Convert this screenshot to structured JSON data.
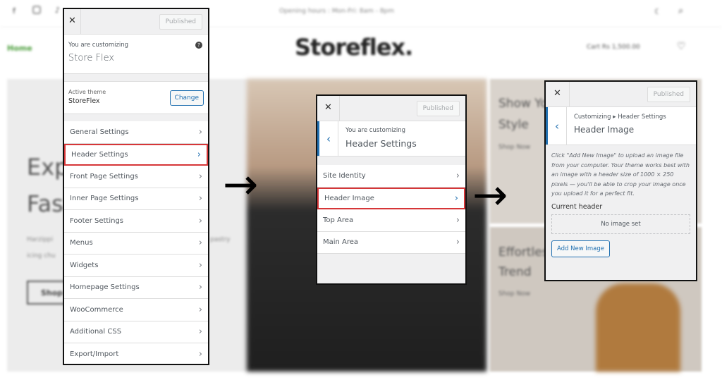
{
  "website": {
    "social_icons": [
      "facebook-icon",
      "instagram-icon",
      "tiktok-icon"
    ],
    "opening_hours": "Opening hours : Mon-Fri: 8am - 8pm",
    "nav_home": "Home",
    "logo": "Storeflex.",
    "cart_text": "Cart Rs 1,500.00",
    "hero_title_1": "Exp",
    "hero_title_2": "Fas",
    "hero_body_1": "Harzippi",
    "hero_body_2": "icing chu",
    "hero_body_3": "pastry",
    "hero_button": "Shop",
    "card1_title_1": "Show Yo",
    "card1_title_2": "Style",
    "card1_link": "Shop Now",
    "card2_title_1": "Effortless",
    "card2_title_2": "Trend",
    "card2_link": "Shop Now",
    "accent": "#2271b1",
    "highlight": "#d63638"
  },
  "panel1": {
    "close": "✕",
    "published": "Published",
    "customizing_label": "You are customizing",
    "site_name": "Store Flex",
    "active_theme_label": "Active theme",
    "theme_name": "StoreFlex",
    "change": "Change",
    "items": [
      {
        "label": "General Settings"
      },
      {
        "label": "Header Settings"
      },
      {
        "label": "Front Page Settings"
      },
      {
        "label": "Inner Page Settings"
      },
      {
        "label": "Footer Settings"
      },
      {
        "label": "Menus"
      },
      {
        "label": "Widgets"
      },
      {
        "label": "Homepage Settings"
      },
      {
        "label": "WooCommerce"
      },
      {
        "label": "Additional CSS"
      },
      {
        "label": "Export/Import"
      }
    ]
  },
  "panel2": {
    "close": "✕",
    "published": "Published",
    "customizing_label": "You are customizing",
    "section": "Header Settings",
    "items": [
      {
        "label": "Site Identity"
      },
      {
        "label": "Header Image"
      },
      {
        "label": "Top Area"
      },
      {
        "label": "Main Area"
      }
    ]
  },
  "panel3": {
    "close": "✕",
    "published": "Published",
    "breadcrumb": "Customizing ▸ Header Settings",
    "section": "Header Image",
    "description": "Click \"Add New Image\" to upload an image file from your computer. Your theme works best with an image with a header size of 1000 × 250 pixels — you'll be able to crop your image once you upload it for a perfect fit.",
    "current_header": "Current header",
    "no_image": "No image set",
    "add_new": "Add New Image"
  },
  "arrows": [
    "→",
    "→"
  ]
}
